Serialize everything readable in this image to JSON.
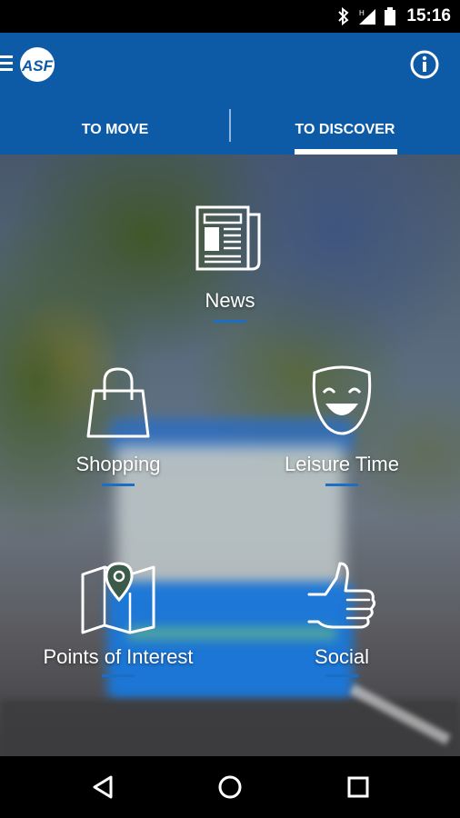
{
  "status_bar": {
    "time": "15:16",
    "icons": [
      "bluetooth-icon",
      "signal-icon",
      "battery-icon"
    ]
  },
  "app_bar": {
    "logo_text": "ASF",
    "menu_icon": "hamburger-icon",
    "info_icon": "info-icon",
    "background_color": "#0d5aa7"
  },
  "tabs": [
    {
      "label": "TO MOVE",
      "selected": false
    },
    {
      "label": "TO DISCOVER",
      "selected": true
    }
  ],
  "menu": {
    "news": {
      "label": "News",
      "icon": "newspaper-icon"
    },
    "shopping": {
      "label": "Shopping",
      "icon": "shopping-bag-icon"
    },
    "leisure": {
      "label": "Leisure Time",
      "icon": "theater-mask-icon"
    },
    "poi": {
      "label": "Points of Interest",
      "icon": "map-pin-icon"
    },
    "social": {
      "label": "Social",
      "icon": "thumbs-up-icon"
    }
  },
  "accent_color": "#1a6fc4",
  "nav_bar": {
    "buttons": [
      "back-icon",
      "home-icon",
      "recents-icon"
    ]
  }
}
